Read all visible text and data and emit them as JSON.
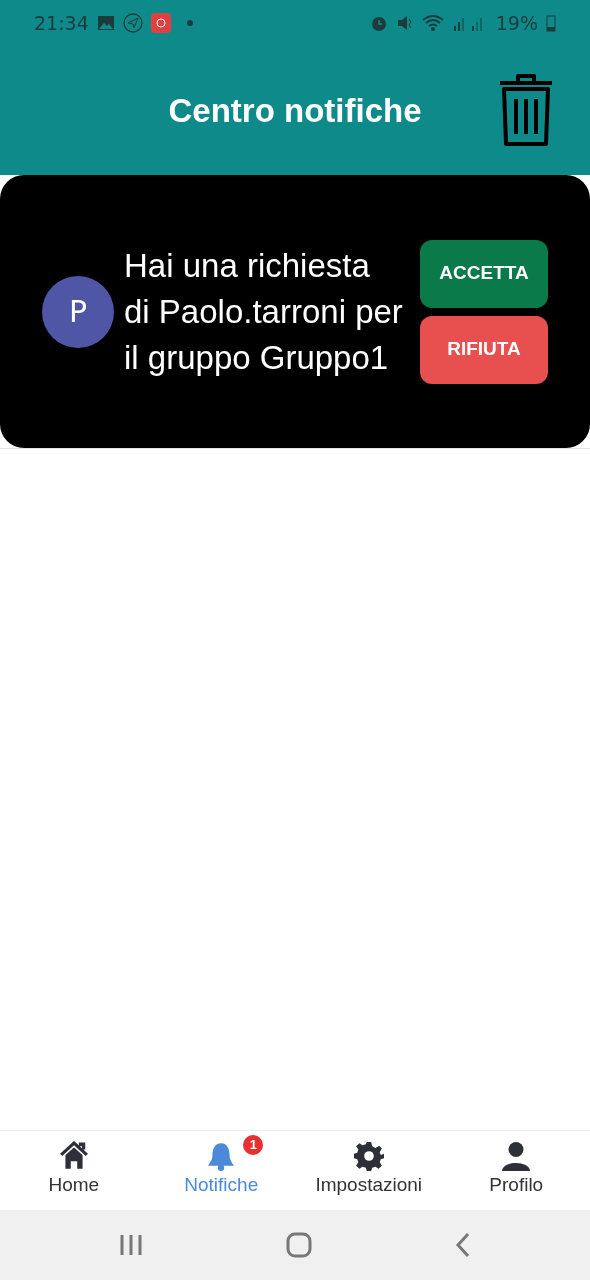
{
  "status_bar": {
    "time": "21:34",
    "battery": "19%"
  },
  "header": {
    "title": "Centro notifiche"
  },
  "notifications": [
    {
      "avatar": "P",
      "message": "Hai una richiesta di Paolo.tarroni per il gruppo Gruppo1",
      "buttons": [
        {
          "label": "ACCETTA",
          "kind": "accept"
        },
        {
          "label": "RIFIUTA",
          "kind": "reject"
        }
      ]
    }
  ],
  "tabs": [
    {
      "label": "Home",
      "kind": "home",
      "selected": false
    },
    {
      "label": "Notifiche",
      "kind": "bell",
      "selected": true,
      "badge": "1"
    },
    {
      "label": "Impostazioni",
      "kind": "gear",
      "selected": false
    },
    {
      "label": "Profilo",
      "kind": "person",
      "selected": false
    }
  ]
}
